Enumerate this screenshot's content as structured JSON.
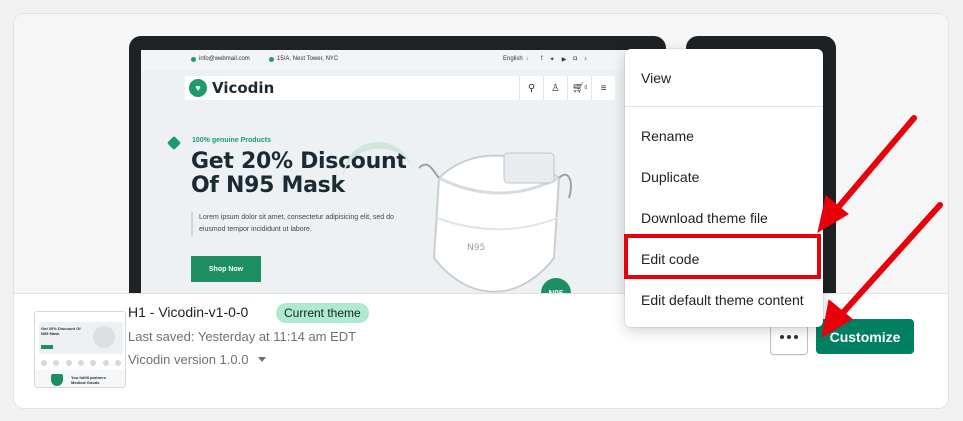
{
  "preview": {
    "email": "info@webmail.com",
    "address": "15/A, Nest Tower, NYC",
    "language": "English",
    "brand": "Vicodin",
    "cart_count": "0",
    "tag": "100% genuine Products",
    "title_line1": "Get 20% Discount",
    "title_line2": "Of N95 Mask",
    "body": "Lorem ipsum dolor sit amet, consectetur adipisicing elit, sed do eiusmod tempor incididunt ut labore.",
    "cta": "Shop Now",
    "mask_label": "N95",
    "badge": "N95"
  },
  "thumbnail": {
    "title": "Get 20% Discount Of N95 Mask",
    "footer_text": "You fulfill partners Medical Goods"
  },
  "theme": {
    "name": "H1 - Vicodin-v1-0-0",
    "status_badge": "Current theme",
    "last_saved": "Last saved: Yesterday at 11:14 am EDT",
    "version": "Vicodin version 1.0.0"
  },
  "actions": {
    "customize_label": "Customize",
    "more_label": "More actions"
  },
  "menu": {
    "items": [
      {
        "label": "View"
      },
      {
        "label": "Rename"
      },
      {
        "label": "Duplicate"
      },
      {
        "label": "Download theme file"
      },
      {
        "label": "Edit code"
      },
      {
        "label": "Edit default theme content"
      }
    ],
    "highlighted": "Edit code"
  },
  "colors": {
    "primary": "#008060",
    "badge_bg": "#aee9d1",
    "annotation": "#e8000b",
    "brand_green": "#1e9b6b"
  }
}
